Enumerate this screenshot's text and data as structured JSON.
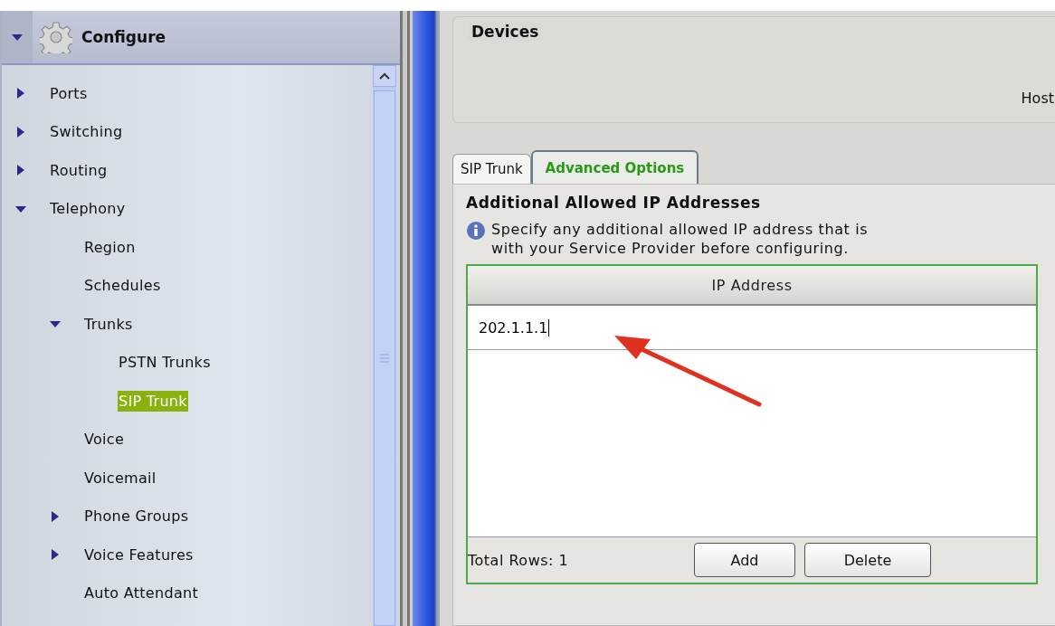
{
  "sidebar": {
    "header": {
      "title": "Configure",
      "expanded": true
    },
    "tree": [
      {
        "label": "Ports",
        "kind": "group",
        "expanded": false,
        "selected": false
      },
      {
        "label": "Switching",
        "kind": "group",
        "expanded": false,
        "selected": false
      },
      {
        "label": "Routing",
        "kind": "group",
        "expanded": false,
        "selected": false
      },
      {
        "label": "Telephony",
        "kind": "group",
        "expanded": true,
        "selected": false,
        "children": [
          {
            "label": "Region",
            "kind": "page",
            "selected": false
          },
          {
            "label": "Schedules",
            "kind": "page",
            "selected": false
          },
          {
            "label": "Trunks",
            "kind": "group",
            "expanded": true,
            "selected": false,
            "children": [
              {
                "label": "PSTN Trunks",
                "kind": "page",
                "selected": false
              },
              {
                "label": "SIP Trunk",
                "kind": "page",
                "selected": true
              }
            ]
          },
          {
            "label": "Voice",
            "kind": "page",
            "selected": false
          },
          {
            "label": "Voicemail",
            "kind": "page",
            "selected": false
          },
          {
            "label": "Phone Groups",
            "kind": "group",
            "expanded": false,
            "selected": false
          },
          {
            "label": "Voice Features",
            "kind": "group",
            "expanded": false,
            "selected": false
          },
          {
            "label": "Auto Attendant",
            "kind": "page",
            "selected": false
          }
        ]
      }
    ]
  },
  "devices": {
    "title": "Devices",
    "field_label": "Host"
  },
  "tabs": [
    {
      "label": "SIP Trunk",
      "selected": false
    },
    {
      "label": "Advanced Options",
      "selected": true
    }
  ],
  "section": {
    "title": "Additional Allowed IP Addresses",
    "info_lines": [
      "Specify any additional allowed IP address that is",
      "with your Service Provider before configuring."
    ],
    "table": {
      "columns": [
        "IP Address"
      ],
      "rows": [
        {
          "ip_address": "202.1.1.1",
          "editing": true
        }
      ]
    },
    "total_rows": "Total Rows: 1",
    "buttons": [
      "Add",
      "Delete"
    ]
  }
}
